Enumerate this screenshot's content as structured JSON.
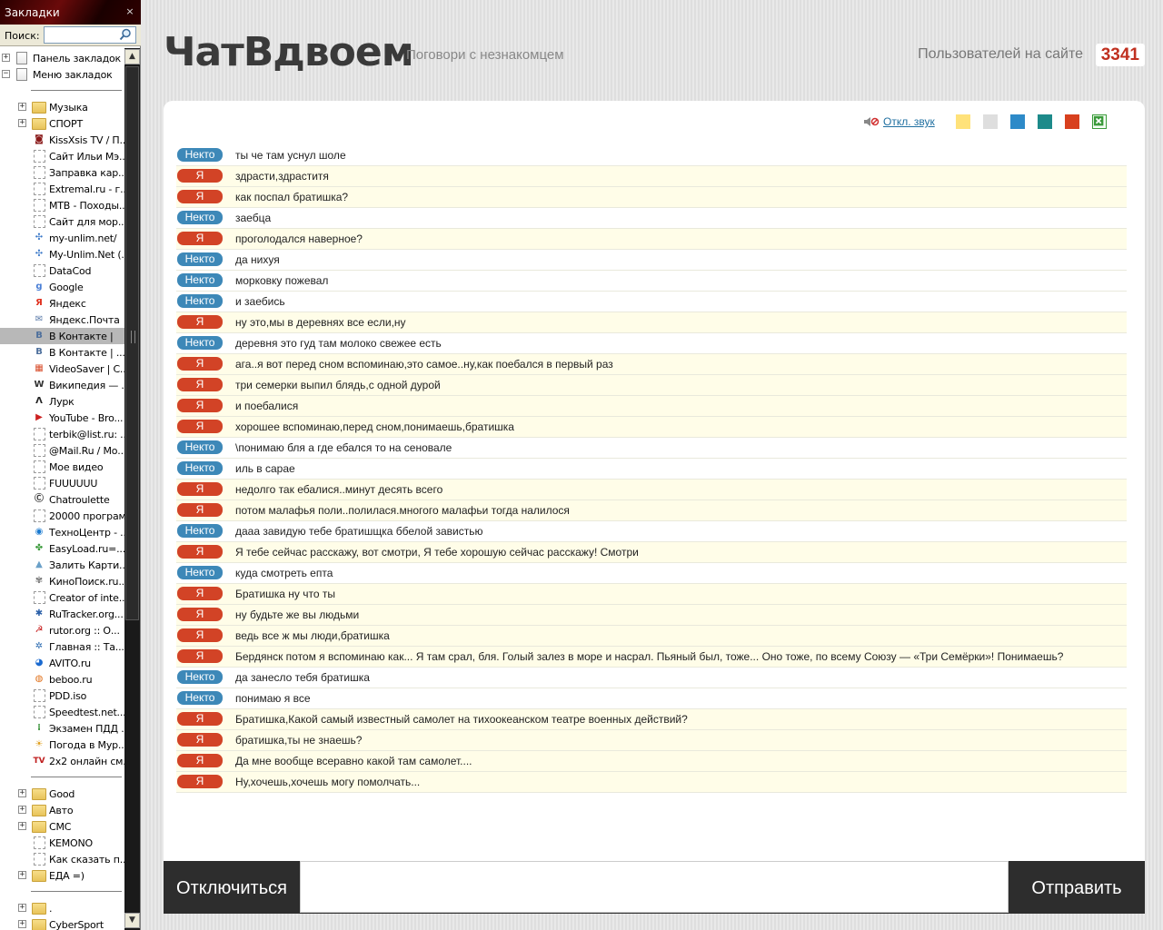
{
  "sidebar": {
    "title": "Закладки",
    "close_glyph": "×",
    "search_label": "Поиск:",
    "search_value": "",
    "root": [
      {
        "label": "Панель закладок",
        "expander": "+",
        "icon": "bookmarks-toolbar-icon"
      },
      {
        "label": "Меню закладок",
        "expander": "−",
        "icon": "bookmarks-menu-icon"
      }
    ],
    "items": [
      {
        "label": "Музыка",
        "icon": "folder-icon",
        "expander": "+"
      },
      {
        "label": "СПОРТ",
        "icon": "folder-icon",
        "expander": "+"
      },
      {
        "label": "KissXsis TV / П...",
        "icon": "site-icon",
        "color": "#8a1a1a",
        "glyph": "◙"
      },
      {
        "label": "Сайт Ильи Мэ...",
        "icon": "blank-page-icon"
      },
      {
        "label": "Заправка кар...",
        "icon": "blank-page-icon"
      },
      {
        "label": "Extremal.ru - г...",
        "icon": "blank-page-icon"
      },
      {
        "label": "MTB - Походы...",
        "icon": "blank-page-icon"
      },
      {
        "label": "Сайт для мор...",
        "icon": "blank-page-icon"
      },
      {
        "label": "my-unlim.net/",
        "icon": "site-icon",
        "color": "#3a78c8",
        "glyph": "✣"
      },
      {
        "label": "My-Unlim.Net (...",
        "icon": "site-icon",
        "color": "#3a78c8",
        "glyph": "✣"
      },
      {
        "label": "DataCod",
        "icon": "blank-page-icon"
      },
      {
        "label": "Google",
        "icon": "site-icon",
        "color": "#4a7fd6",
        "glyph": "g"
      },
      {
        "label": "Яндекс",
        "icon": "site-icon",
        "color": "#e0301e",
        "glyph": "Я"
      },
      {
        "label": "Яндекс.Почта",
        "icon": "site-icon",
        "color": "#5a7aa8",
        "glyph": "✉"
      },
      {
        "label": "В Контакте |",
        "icon": "site-icon",
        "color": "#4d6f9c",
        "glyph": "B",
        "selected": true
      },
      {
        "label": "В Контакте | ...",
        "icon": "site-icon",
        "color": "#4d6f9c",
        "glyph": "B"
      },
      {
        "label": "VideoSaver | С...",
        "icon": "site-icon",
        "color": "#d84c2a",
        "glyph": "▦"
      },
      {
        "label": "Википедия — ...",
        "icon": "site-icon",
        "color": "#333333",
        "glyph": "W"
      },
      {
        "label": "Лурк",
        "icon": "site-icon",
        "color": "#222222",
        "glyph": "Λ"
      },
      {
        "label": "YouTube - Bro...",
        "icon": "site-icon",
        "color": "#cc2020",
        "glyph": "▶"
      },
      {
        "label": "terbik@list.ru: ...",
        "icon": "blank-page-icon"
      },
      {
        "label": "@Mail.Ru / Мо...",
        "icon": "blank-page-icon"
      },
      {
        "label": "Мое видео",
        "icon": "blank-page-icon"
      },
      {
        "label": "FUUUUUU",
        "icon": "blank-page-icon"
      },
      {
        "label": "Chatroulette",
        "icon": "site-icon",
        "color": "#333333",
        "glyph": "Ⓒ"
      },
      {
        "label": "20000 программ",
        "icon": "blank-page-icon"
      },
      {
        "label": "ТехноЦентр - ...",
        "icon": "site-icon",
        "color": "#1a7ad0",
        "glyph": "◉"
      },
      {
        "label": "EasyLoad.ru=...",
        "icon": "site-icon",
        "color": "#3a9a3a",
        "glyph": "✤"
      },
      {
        "label": "Залить Карти...",
        "icon": "site-icon",
        "color": "#6aa0c8",
        "glyph": "▲"
      },
      {
        "label": "КиноПоиск.ru...",
        "icon": "site-icon",
        "color": "#777777",
        "glyph": "✾"
      },
      {
        "label": "Creator of inte...",
        "icon": "blank-page-icon"
      },
      {
        "label": "RuTracker.org...",
        "icon": "site-icon",
        "color": "#2a5fa8",
        "glyph": "✱"
      },
      {
        "label": "rutor.org :: О...",
        "icon": "site-icon",
        "color": "#c82020",
        "glyph": "☭"
      },
      {
        "label": "Главная :: Та...",
        "icon": "site-icon",
        "color": "#2a6ab0",
        "glyph": "✲"
      },
      {
        "label": "AVITO.ru",
        "icon": "site-icon",
        "color": "#1a6ad0",
        "glyph": "◕"
      },
      {
        "label": "beboo.ru",
        "icon": "site-icon",
        "color": "#e0701a",
        "glyph": "◍"
      },
      {
        "label": "PDD.iso",
        "icon": "blank-page-icon"
      },
      {
        "label": "Speedtest.net...",
        "icon": "blank-page-icon"
      },
      {
        "label": "Экзамен ПДД ...",
        "icon": "site-icon",
        "color": "#2a8a2a",
        "glyph": "⁞"
      },
      {
        "label": "Погода в Мур...",
        "icon": "site-icon",
        "color": "#e0a020",
        "glyph": "☀"
      },
      {
        "label": "2х2 онлайн см...",
        "icon": "site-icon",
        "color": "#c02020",
        "glyph": "TV"
      }
    ],
    "items2": [
      {
        "label": "Good",
        "icon": "folder-icon",
        "expander": "+"
      },
      {
        "label": "Авто",
        "icon": "folder-icon",
        "expander": "+"
      },
      {
        "label": "СМС",
        "icon": "folder-icon",
        "expander": "+"
      },
      {
        "label": "KEMONO",
        "icon": "blank-page-icon"
      },
      {
        "label": "Как сказать п...",
        "icon": "blank-page-icon"
      },
      {
        "label": "ЕДА =)",
        "icon": "folder-icon",
        "expander": "+"
      }
    ],
    "items3": [
      {
        "label": ".",
        "icon": "folder-icon",
        "expander": "+"
      },
      {
        "label": "CyberSport",
        "icon": "folder-icon",
        "expander": "+"
      }
    ]
  },
  "header": {
    "logo": "ЧатВдвоем",
    "tagline": "Поговори с незнакомцем",
    "users_label": "Пользователей на сайте",
    "users_count": "3341"
  },
  "toolbar": {
    "sound_label": "Откл. звук",
    "swatches": [
      "#ffe27a",
      "#dedede",
      "#2d8ac8",
      "#1d8a8a",
      "#d8401e",
      "#3a9a3a"
    ]
  },
  "colors": {
    "stranger": "#3d88b8",
    "me": "#d24326",
    "bar": "#2d2d2d"
  },
  "messages": [
    {
      "who": "Некто",
      "role": "stranger",
      "text": "ты че там уснул шоле"
    },
    {
      "who": "Я",
      "role": "me",
      "text": "здрасти,здраститя"
    },
    {
      "who": "Я",
      "role": "me",
      "text": "как поспал братишка?"
    },
    {
      "who": "Некто",
      "role": "stranger",
      "text": "заебца"
    },
    {
      "who": "Я",
      "role": "me",
      "text": "проголодался наверное?"
    },
    {
      "who": "Некто",
      "role": "stranger",
      "text": "да нихуя"
    },
    {
      "who": "Некто",
      "role": "stranger",
      "text": "морковку пожевал"
    },
    {
      "who": "Некто",
      "role": "stranger",
      "text": "и заебись"
    },
    {
      "who": "Я",
      "role": "me",
      "text": "ну это,мы в деревнях все если,ну"
    },
    {
      "who": "Некто",
      "role": "stranger",
      "text": "деревня это гуд там молоко свежее есть"
    },
    {
      "who": "Я",
      "role": "me",
      "text": "ага..я вот перед сном вспоминаю,это самое..ну,как поебался в первый раз"
    },
    {
      "who": "Я",
      "role": "me",
      "text": "три семерки выпил блядь,с одной дурой"
    },
    {
      "who": "Я",
      "role": "me",
      "text": "и поебалися"
    },
    {
      "who": "Я",
      "role": "me",
      "text": "хорошее вспоминаю,перед сном,понимаешь,братишка"
    },
    {
      "who": "Некто",
      "role": "stranger",
      "text": "\\понимаю бля а где ебался то на сеновале"
    },
    {
      "who": "Некто",
      "role": "stranger",
      "text": "иль в сарае"
    },
    {
      "who": "Я",
      "role": "me",
      "text": "недолго так ебалися..минут десять всего"
    },
    {
      "who": "Я",
      "role": "me",
      "text": "потом малафья поли..полилася.многого малафьи тогда налилося"
    },
    {
      "who": "Некто",
      "role": "stranger",
      "text": "дааа завидую тебе братишщка ббелой завистью"
    },
    {
      "who": "Я",
      "role": "me",
      "text": "Я тебе сейчас расскажу, вот смотри, Я тебе хорошую сейчас расскажу! Смотри"
    },
    {
      "who": "Некто",
      "role": "stranger",
      "text": "куда смотреть епта"
    },
    {
      "who": "Я",
      "role": "me",
      "text": "Братишка ну что ты"
    },
    {
      "who": "Я",
      "role": "me",
      "text": "ну будьте же вы людьми"
    },
    {
      "who": "Я",
      "role": "me",
      "text": "ведь все ж мы люди,братишка"
    },
    {
      "who": "Я",
      "role": "me",
      "text": "Бердянск потом я вспоминаю как... Я там срал, бля. Голый залез в море и насрал. Пьяный был, тоже... Оно тоже, по всему Союзу — «Три Семёрки»! Понимаешь?"
    },
    {
      "who": "Некто",
      "role": "stranger",
      "text": "да занесло тебя братишка"
    },
    {
      "who": "Некто",
      "role": "stranger",
      "text": "понимаю я все"
    },
    {
      "who": "Я",
      "role": "me",
      "text": "Братишка,Какой самый известный самолет на тихоокеанском театре военных действий?"
    },
    {
      "who": "Я",
      "role": "me",
      "text": "братишка,ты не знаешь?"
    },
    {
      "who": "Я",
      "role": "me",
      "text": "Да мне вообще всеравно какой там самолет...."
    },
    {
      "who": "Я",
      "role": "me",
      "text": "Ну,хочешь,хочешь могу помолчать..."
    }
  ],
  "bottom": {
    "disconnect_label": "Отключиться",
    "input_value": "",
    "send_label": "Отправить"
  }
}
